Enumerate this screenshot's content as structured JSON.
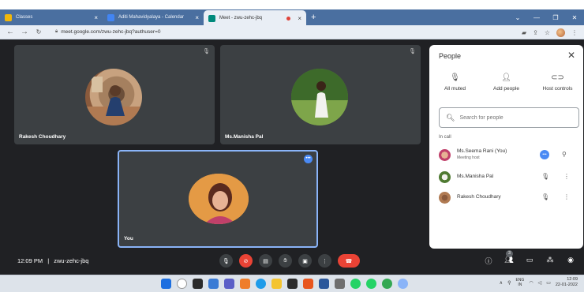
{
  "browser": {
    "tabs": [
      {
        "label": "Classes",
        "active": false
      },
      {
        "label": "Aditi Mahavidyalaya - Calendar",
        "active": false
      },
      {
        "label": "Meet - zwu-zehc-jbq",
        "active": true
      }
    ],
    "new_tab": "+",
    "close_glyph": "×",
    "url": "meet.google.com/zwu-zehc-jbq?authuser=0"
  },
  "meeting": {
    "code": "zwu-zehc-jbq",
    "time": "12:09 PM",
    "separator": "|",
    "tiles": [
      {
        "name": "Rakesh Choudhary"
      },
      {
        "name": "Ms.Manisha Pal"
      },
      {
        "name": "You"
      }
    ],
    "participant_badge": "3"
  },
  "people_panel": {
    "title": "People",
    "actions": [
      {
        "label": "All muted",
        "icon": "mic-off-icon"
      },
      {
        "label": "Add people",
        "icon": "add-person-icon"
      },
      {
        "label": "Host controls",
        "icon": "toggle-icon"
      }
    ],
    "search_placeholder": "Search for people",
    "section_label": "In call",
    "participants": [
      {
        "name": "Ms.Seema Rani (You)",
        "sub": "Meeting host"
      },
      {
        "name": "Ms.Manisha Pal",
        "sub": ""
      },
      {
        "name": "Rakesh Choudhary",
        "sub": ""
      }
    ]
  },
  "taskbar": {
    "lang_top": "ENG",
    "lang_bottom": "IN",
    "clock_time": "12:09",
    "clock_date": "22-01-2022"
  },
  "colors": {
    "meet_bg": "#202124",
    "tile_bg": "#3c4043",
    "accent_blue": "#4a8af4",
    "hangup_red": "#ea4335",
    "tabstrip": "#4a6fa0"
  }
}
